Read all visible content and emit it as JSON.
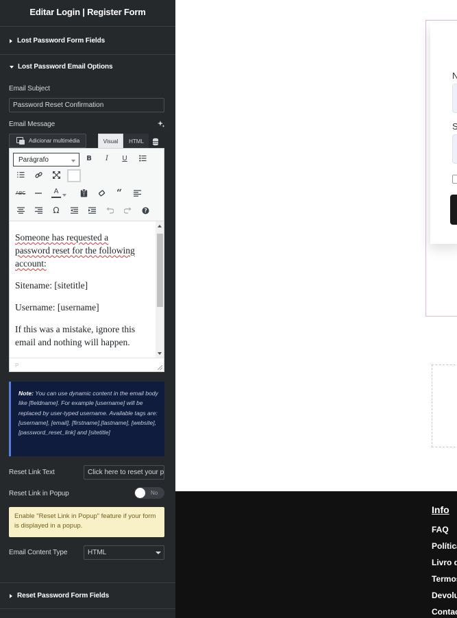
{
  "sidebar": {
    "title": "Editar Login | Register Form",
    "sections": {
      "lost_password_fields": "Lost Password Form Fields",
      "lost_password_email": "Lost Password Email Options",
      "reset_password_fields": "Reset Password Form Fields"
    },
    "email_subject": {
      "label": "Email Subject",
      "value": "Password Reset Confirmation"
    },
    "email_message": {
      "label": "Email Message"
    },
    "editor": {
      "add_media": "Adicionar multimédia",
      "tab_visual": "Visual",
      "tab_html": "HTML",
      "format": "Parágrafo",
      "content": {
        "p1": "Someone has requested a password reset for the following account:",
        "p2": "Sitename: [sitetitle]",
        "p3": "Username: [username]",
        "p4": "If this was a mistake, ignore this email and nothing will happen."
      },
      "status_path": "P"
    },
    "note": {
      "label": "Note:",
      "text": " You can use dynamic content in the email body like [fieldname]. For example [username] will be replaced by user-typed username. Available tags are: [username], [email], [firstname],[lastname], [website], [password_reset_link] and [sitetitle]"
    },
    "reset_link_text": {
      "label": "Reset Link Text",
      "value": "Click here to reset your pa"
    },
    "reset_link_popup": {
      "label": "Reset Link in Popup",
      "state": "No"
    },
    "warning": "Enable \"Reset Link in Popup\" feature if your form is displayed in a popup.",
    "email_content_type": {
      "label": "Email Content Type",
      "value": "HTML"
    }
  },
  "canvas": {
    "form": {
      "field1_label": "N",
      "field2_label": "S"
    },
    "footer": {
      "heading": "Info",
      "links": [
        "FAQ",
        "Política",
        "Livro d",
        "Termos",
        "Devolu",
        "Contac"
      ]
    }
  },
  "icons": {
    "toolbar_row1": [
      "bold-icon",
      "italic-icon",
      "underline-icon",
      "bullet-list-icon"
    ],
    "toolbar_row2": [
      "numbered-list-icon",
      "link-icon",
      "fullscreen-icon",
      "text-color-swatch"
    ],
    "toolbar_row3": [
      "strikethrough-icon",
      "horizontal-rule-icon",
      "text-color-icon",
      "paste-text-icon",
      "clear-format-icon",
      "blockquote-icon",
      "align-left-icon"
    ],
    "toolbar_row4": [
      "align-center-icon",
      "align-right-icon",
      "special-char-icon",
      "outdent-icon",
      "indent-icon",
      "undo-icon",
      "redo-icon",
      "help-icon"
    ]
  },
  "colors": {
    "sidebar_bg": "#26292c",
    "note_bg": "#0f1c3d",
    "warning_bg": "#f8f1c7",
    "footer_bg": "#111111",
    "frame_pink": "#e3b3e6"
  }
}
